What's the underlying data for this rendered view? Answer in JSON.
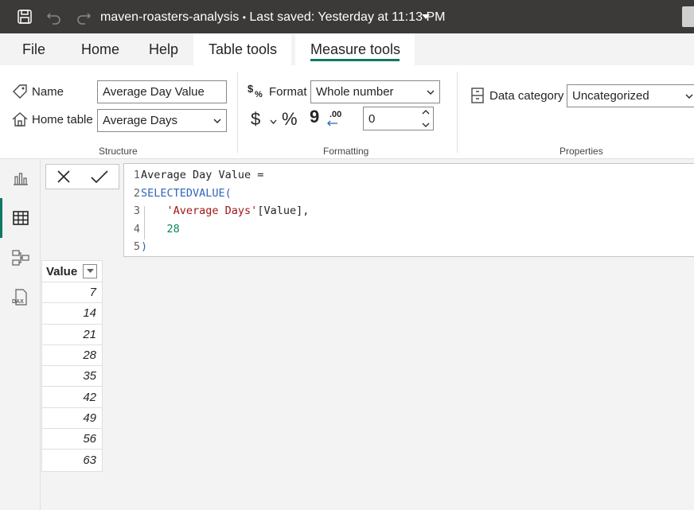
{
  "titlebar": {
    "file_name": "maven-roasters-analysis",
    "separator": "•",
    "saved_status": "Last saved: Yesterday at 11:13 PM"
  },
  "tabs": [
    {
      "label": "File"
    },
    {
      "label": "Home"
    },
    {
      "label": "Help"
    },
    {
      "label": "Table tools"
    },
    {
      "label": "Measure tools"
    }
  ],
  "ribbon": {
    "structure": {
      "group_label": "Structure",
      "name_label": "Name",
      "name_value": "Average Day Value",
      "home_table_label": "Home table",
      "home_table_value": "Average Days"
    },
    "formatting": {
      "group_label": "Formatting",
      "format_label": "Format",
      "format_value": "Whole number",
      "currency_symbol": "$",
      "percent_symbol": "%",
      "comma_symbol": "9",
      "decimal_symbol": ".00",
      "decimal_places": "0"
    },
    "properties": {
      "group_label": "Properties",
      "data_category_label": "Data category",
      "data_category_value": "Uncategorized"
    }
  },
  "formula": {
    "lines": [
      {
        "num": "1",
        "tokens": [
          {
            "t": "Average Day Value =",
            "c": "c-plain"
          }
        ]
      },
      {
        "num": "2",
        "tokens": [
          {
            "t": "SELECTEDVALUE(",
            "c": "c-func"
          }
        ]
      },
      {
        "num": "3",
        "tokens": [
          {
            "t": "    ",
            "c": "c-plain"
          },
          {
            "t": "'Average Days'",
            "c": "c-str"
          },
          {
            "t": "[Value],",
            "c": "c-table"
          }
        ]
      },
      {
        "num": "4",
        "tokens": [
          {
            "t": "    ",
            "c": "c-plain"
          },
          {
            "t": "28",
            "c": "c-num"
          }
        ]
      },
      {
        "num": "5",
        "tokens": [
          {
            "t": ")",
            "c": "c-func"
          }
        ]
      }
    ]
  },
  "table": {
    "column_header": "Value",
    "rows": [
      "7",
      "14",
      "21",
      "28",
      "35",
      "42",
      "49",
      "56",
      "63"
    ]
  },
  "colors": {
    "accent": "#117865",
    "titlebar": "#3b3a39",
    "dax_function": "#3165bb",
    "dax_string": "#a31515",
    "dax_number": "#098658"
  },
  "icons": [
    "save-icon",
    "undo-icon",
    "redo-icon",
    "tag-icon",
    "home-icon",
    "format-icon",
    "data-category-icon",
    "report-view-icon",
    "table-view-icon",
    "model-view-icon",
    "dax-query-icon",
    "cancel-icon",
    "commit-icon"
  ]
}
